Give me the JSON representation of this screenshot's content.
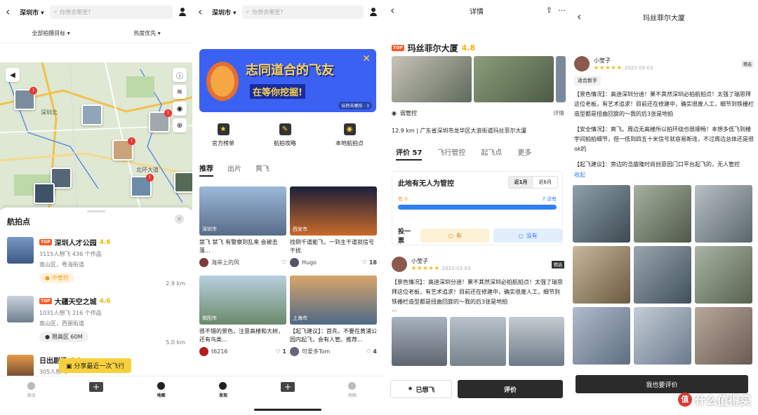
{
  "map_screen": {
    "city": "深圳市",
    "search_placeholder": "你想去哪里?",
    "filter_target": "全部拍摄目标",
    "filter_sort": "热度优先",
    "map_labels": {
      "a": "深圳北",
      "b": "北环大道"
    },
    "sheet_title": "航拍点",
    "spots": [
      {
        "tag": "TOP",
        "name": "深圳人才公园",
        "score": "4.6",
        "stats": "3115人想飞   436 个作品",
        "district": "南山区，粤海街道",
        "distance": "2.9 km",
        "status": "中管控",
        "status_color": "#f39c12"
      },
      {
        "tag": "TOP",
        "name": "大疆天空之城",
        "score": "4.6",
        "stats": "1031人想飞   216 个作品",
        "district": "南山区，西丽街道",
        "distance": "5.0 km",
        "status": "限高区 60M",
        "status_color": "#333333"
      },
      {
        "tag": "",
        "name": "日出剧场",
        "score": "4.1",
        "stats": "305人想飞"
      }
    ],
    "share_button": "分享最近一次飞行",
    "tabs": {
      "discover": "发现",
      "map": "地图"
    }
  },
  "feed_screen": {
    "city": "深圳市",
    "search_placeholder": "你想去哪里?",
    "banner": {
      "line1": "志同道合的飞友",
      "line2": "在等你挖掘!",
      "badge": "玩转去哪拍 · 3"
    },
    "quick": [
      "官方榜单",
      "航拍攻略",
      "本地航拍点"
    ],
    "tabs": [
      "推荐",
      "出片",
      "爽飞"
    ],
    "cards": [
      {
        "loc": "深圳市",
        "text": "禁飞  禁飞  有警察到乱来  会被击落...",
        "user": "海岸上的风",
        "likes": ""
      },
      {
        "loc": "西安市",
        "text": "找倒千道能飞，一到主干道就信号干扰",
        "user": "Hugo",
        "likes": "18"
      },
      {
        "loc": "揭阳市",
        "text": "很不错的景色，注意高楼和大树，还有鸟类...",
        "user": "t6216",
        "likes": "1"
      },
      {
        "loc": "上海市",
        "text": "【起飞建议】：首先，不要在黄浦公园内起飞，会有人管。推荐...",
        "user": "可爱多Tom",
        "likes": "4"
      }
    ],
    "tabbar": {
      "discover": "发现",
      "map": "地图"
    }
  },
  "detail_screen": {
    "header": "详情",
    "title": "玛丝菲尔大厦",
    "tag": "TOP",
    "score": "4.8",
    "control": "弱管控",
    "detail_link": "详情",
    "address": "12.9 km | 广东省深圳市龙华区大浪街道玛丝菲尔大厦",
    "tabs": [
      "评价 57",
      "飞行管控",
      "起飞点",
      "更多"
    ],
    "poll": {
      "question": "此地有无人为管控",
      "range_a": "近1月",
      "range_b": "近6月",
      "yes_count": "有 0",
      "no_count": "7 没有",
      "vote_label": "投一票",
      "yes": "有",
      "no": "没有",
      "yes_ratio": 0,
      "no_ratio": 1
    },
    "review": {
      "user": "小莹子",
      "stars": "★★★★★",
      "date": "2022-03-03",
      "badge": "精选",
      "text": "【景色情况】：高迪深圳分迪！果不其然深圳必拍航拍点！太强了瑞思拜这位老板，有艺术追求！目前还在修建中，确实很废人工，细节到铁栅栏造型都是扭曲回旋的～我的后3张是地拍",
      "more": "..."
    },
    "want_button": "已想飞",
    "review_button": "评价"
  },
  "review_screen": {
    "header": "玛丝菲尔大厦",
    "user": "小莹子",
    "stars": "★★★★★",
    "date": "2022-03-03",
    "badge": "精选",
    "tag": "适合新手",
    "p1": "【景色情况】：高迪深圳分迪！果不其然深圳必拍航拍点！太强了瑞思拜这位老板，有艺术追求！目前还在修建中，确实很废人工，细节到铁栅栏造型都是扭曲回旋的～我的后3张是地拍",
    "p2": "【安全情况】：爽飞。周边无高楼所以拍环绕也很顺畅！本想多低飞到楼宇间拍拍细节，但一低到四五十米信号就容易断连，不过周边总体还是很ok的",
    "p3": "【起飞建议】：旁边的浩盛隆时尚创意园门口平台起飞的，无人管控",
    "collapse": "收起",
    "write_button": "我也要评价",
    "watermark": "什么值得买"
  }
}
